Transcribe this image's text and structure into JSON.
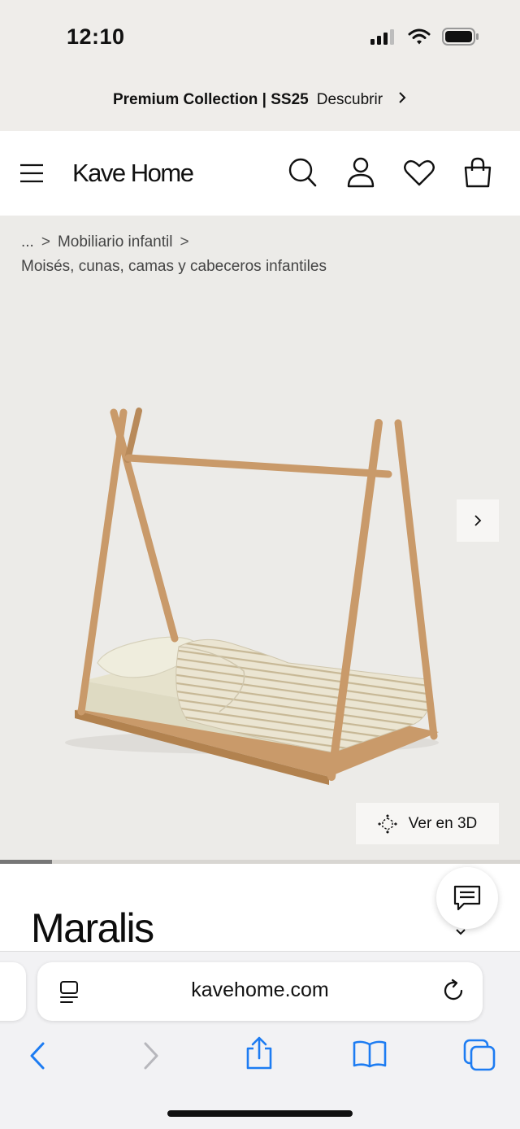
{
  "status_bar": {
    "time": "12:10"
  },
  "promo": {
    "collection": "Premium Collection | SS25",
    "link": "Descubrir"
  },
  "nav": {
    "logo": "Kave Home"
  },
  "breadcrumb": {
    "ellipsis": "...",
    "level1": "Mobiliario infantil",
    "level2": "Moisés, cunas, camas y cabeceros infantiles"
  },
  "gallery": {
    "view3d_label": "Ver en 3D",
    "progress_fraction": 0.1
  },
  "product": {
    "title": "Maralis"
  },
  "browser": {
    "url": "kavehome.com"
  },
  "colors": {
    "page_bg": "#ecebe8",
    "promo_bg": "#efedea",
    "wood": "#c99a6a",
    "ios_blue": "#1d7cf2"
  }
}
